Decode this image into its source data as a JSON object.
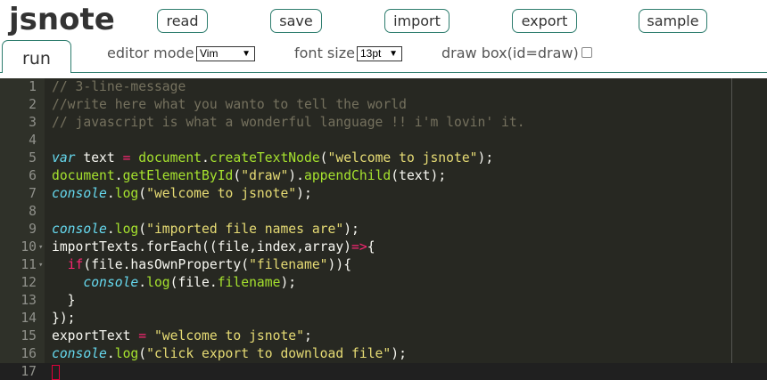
{
  "app": {
    "logo": "jsnote"
  },
  "toolbar": {
    "buttons": [
      {
        "id": "read",
        "label": "read"
      },
      {
        "id": "save",
        "label": "save"
      },
      {
        "id": "import",
        "label": "import"
      },
      {
        "id": "export",
        "label": "export"
      },
      {
        "id": "sample",
        "label": "sample"
      }
    ]
  },
  "tab": {
    "run_label": "run"
  },
  "options": {
    "editor_mode_label": "editor mode",
    "editor_mode_value": "Vim",
    "font_size_label": "font size",
    "font_size_value": "13pt",
    "draw_box_label": "draw box(id=draw)",
    "dropdown_arrow": "▼"
  },
  "editor": {
    "theme_colors": {
      "background": "#272822",
      "gutter": "#2f3129",
      "comment": "#75715e",
      "keyword": "#66d9ef",
      "operator": "#f92672",
      "function": "#a6e22e",
      "string": "#e6db74"
    },
    "fold_marker": "▾",
    "lines": [
      {
        "n": "1",
        "tokens": [
          [
            "cm",
            "// 3-line-message"
          ]
        ]
      },
      {
        "n": "2",
        "tokens": [
          [
            "cm",
            "//write here what you wanto to tell the world"
          ]
        ]
      },
      {
        "n": "3",
        "tokens": [
          [
            "cm",
            "// javascript is what a wonderful language !! i'm lovin' it."
          ]
        ]
      },
      {
        "n": "4",
        "tokens": []
      },
      {
        "n": "5",
        "tokens": [
          [
            "kw",
            "var"
          ],
          [
            "id",
            " text "
          ],
          [
            "op",
            "="
          ],
          [
            "id",
            " "
          ],
          [
            "fn",
            "document"
          ],
          [
            "pn",
            "."
          ],
          [
            "fn",
            "createTextNode"
          ],
          [
            "pn",
            "("
          ],
          [
            "str",
            "\"welcome to jsnote\""
          ],
          [
            "pn",
            ");"
          ]
        ]
      },
      {
        "n": "6",
        "tokens": [
          [
            "fn",
            "document"
          ],
          [
            "pn",
            "."
          ],
          [
            "fn",
            "getElementById"
          ],
          [
            "pn",
            "("
          ],
          [
            "str",
            "\"draw\""
          ],
          [
            "pn",
            ")."
          ],
          [
            "fn",
            "appendChild"
          ],
          [
            "pn",
            "(text);"
          ]
        ]
      },
      {
        "n": "7",
        "tokens": [
          [
            "kw",
            "console"
          ],
          [
            "pn",
            "."
          ],
          [
            "fn",
            "log"
          ],
          [
            "pn",
            "("
          ],
          [
            "str",
            "\"welcome to jsnote\""
          ],
          [
            "pn",
            ");"
          ]
        ]
      },
      {
        "n": "8",
        "tokens": []
      },
      {
        "n": "9",
        "tokens": [
          [
            "kw",
            "console"
          ],
          [
            "pn",
            "."
          ],
          [
            "fn",
            "log"
          ],
          [
            "pn",
            "("
          ],
          [
            "str",
            "\"imported file names are\""
          ],
          [
            "pn",
            ");"
          ]
        ]
      },
      {
        "n": "10",
        "fold": true,
        "tokens": [
          [
            "id",
            "importTexts.forEach((file,index,array)"
          ],
          [
            "op",
            "=>"
          ],
          [
            "pn",
            "{"
          ]
        ]
      },
      {
        "n": "11",
        "fold": true,
        "tokens": [
          [
            "id",
            "  "
          ],
          [
            "op",
            "if"
          ],
          [
            "pn",
            "(file.hasOwnProperty("
          ],
          [
            "str",
            "\"filename\""
          ],
          [
            "pn",
            ")){"
          ]
        ]
      },
      {
        "n": "12",
        "tokens": [
          [
            "id",
            "    "
          ],
          [
            "kw",
            "console"
          ],
          [
            "pn",
            "."
          ],
          [
            "fn",
            "log"
          ],
          [
            "pn",
            "(file."
          ],
          [
            "fn",
            "filename"
          ],
          [
            "pn",
            ");"
          ]
        ]
      },
      {
        "n": "13",
        "tokens": [
          [
            "pn",
            "  }"
          ]
        ]
      },
      {
        "n": "14",
        "tokens": [
          [
            "pn",
            "});"
          ]
        ]
      },
      {
        "n": "15",
        "tokens": [
          [
            "id",
            "exportText "
          ],
          [
            "op",
            "="
          ],
          [
            "id",
            " "
          ],
          [
            "str",
            "\"welcome to jsnote\""
          ],
          [
            "pn",
            ";"
          ]
        ]
      },
      {
        "n": "16",
        "tokens": [
          [
            "kw",
            "console"
          ],
          [
            "pn",
            "."
          ],
          [
            "fn",
            "log"
          ],
          [
            "pn",
            "("
          ],
          [
            "str",
            "\"click export to download file\""
          ],
          [
            "pn",
            ");"
          ]
        ]
      },
      {
        "n": "17",
        "active": true,
        "tokens": []
      }
    ]
  }
}
